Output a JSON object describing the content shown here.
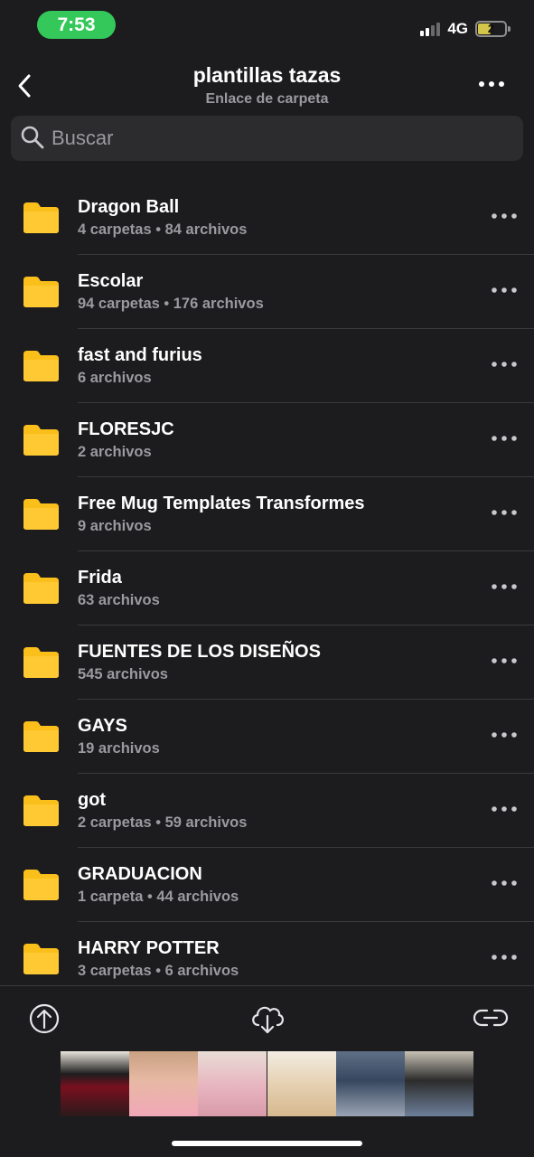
{
  "status_bar": {
    "time": "7:53",
    "network": "4G",
    "battery": "2",
    "signal_bars_active": 2,
    "signal_bars_total": 4,
    "battery_level": 0.4,
    "time_bg_color": "#34c759"
  },
  "header": {
    "title": "plantillas tazas",
    "subtitle": "Enlace de carpeta",
    "back_icon": "chevron-left-icon",
    "more_icon": "more-horizontal-icon"
  },
  "search": {
    "placeholder": "Buscar",
    "icon": "search-icon"
  },
  "folders": [
    {
      "name": "Dragon Ball",
      "meta": "4 carpetas • 84 archivos"
    },
    {
      "name": "Escolar",
      "meta": "94 carpetas • 176 archivos"
    },
    {
      "name": "fast and furius",
      "meta": "6 archivos"
    },
    {
      "name": "FLORESJC",
      "meta": "2 archivos"
    },
    {
      "name": "Free Mug Templates Transformes",
      "meta": "9 archivos"
    },
    {
      "name": "Frida",
      "meta": "63 archivos"
    },
    {
      "name": "FUENTES DE LOS DISEÑOS",
      "meta": "545 archivos"
    },
    {
      "name": "GAYS",
      "meta": "19 archivos"
    },
    {
      "name": "got",
      "meta": "2 carpetas • 59 archivos"
    },
    {
      "name": "GRADUACION",
      "meta": "1 carpeta • 44 archivos"
    },
    {
      "name": "HARRY POTTER",
      "meta": "3 carpetas • 6 archivos"
    }
  ],
  "toolbar": {
    "upload_icon": "upload-icon",
    "download_icon": "cloud-download-icon",
    "link_icon": "link-icon"
  },
  "colors": {
    "background": "#1c1c1e",
    "folder": "#fbbf1c",
    "secondary_text": "#9a9a9f",
    "divider": "#3a3a3c"
  },
  "ad_banner": {
    "tiles": 6
  }
}
